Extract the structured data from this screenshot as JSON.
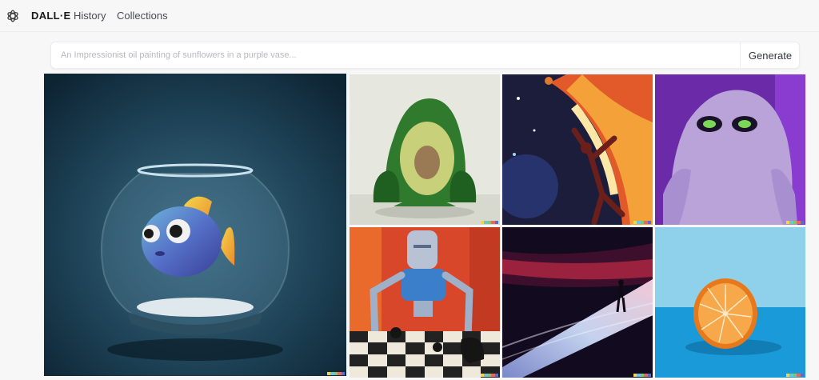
{
  "header": {
    "brand": "DALL·E",
    "nav": {
      "history": "History",
      "collections": "Collections"
    }
  },
  "search": {
    "placeholder": "An Impressionist oil painting of sunflowers in a purple vase...",
    "value": "",
    "generate_label": "Generate"
  },
  "gallery": {
    "items": [
      {
        "name": "fish-in-bowl-image"
      },
      {
        "name": "avocado-armchair-image"
      },
      {
        "name": "basketball-player-painting-image"
      },
      {
        "name": "purple-monster-image"
      },
      {
        "name": "robot-chess-painting-image"
      },
      {
        "name": "figure-in-light-image"
      },
      {
        "name": "orange-half-image"
      }
    ]
  },
  "signature_colors": [
    "#f5d547",
    "#6ac4dd",
    "#7bc96f",
    "#e46a5f",
    "#5a6bd4"
  ]
}
